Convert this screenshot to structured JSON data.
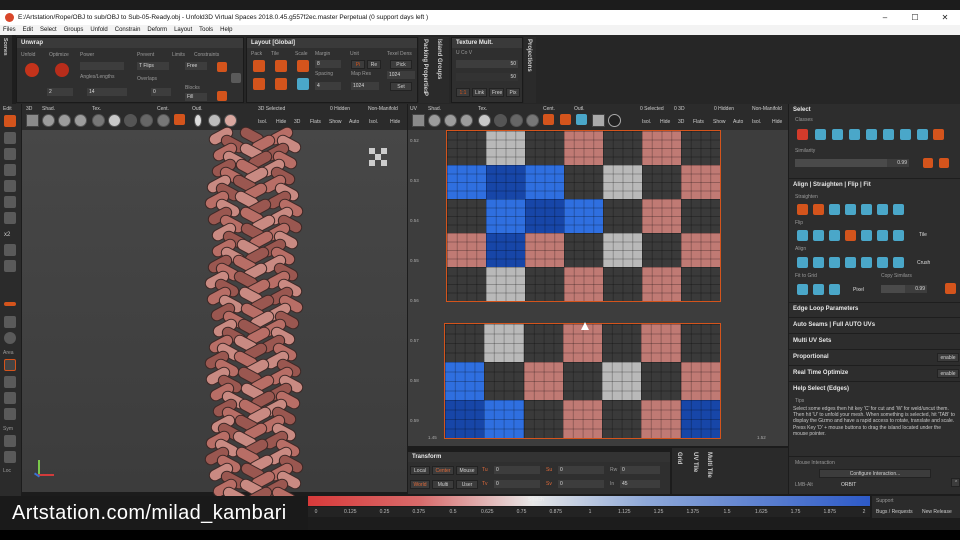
{
  "titlebar": {
    "title": "E:/Artstation/Rope/OBJ to sub/OBJ to Sub-05-Ready.obj - Unfold3D  Virtual Spaces 2018.0.45.g557f2ec.master Perpetual  (0 support days left )",
    "minimize": "–",
    "maximize": "☐",
    "close": "✕"
  },
  "menu": [
    "Files",
    "Edit",
    "Select",
    "Groups",
    "Unfold",
    "Constrain",
    "Deform",
    "Layout",
    "Tools",
    "Help"
  ],
  "left_strip": {
    "scenes": "Scenes",
    "edit": "Edit",
    "x2": "x2",
    "area": "Area",
    "sym": "Sym",
    "loc": "Loc"
  },
  "unwrap": {
    "title": "Unwrap",
    "labels": {
      "unfold": "Unfold",
      "optimize": "Optimize",
      "power": "Power",
      "prevent": "Prevent",
      "limits": "Limits",
      "constraints": "Constraints",
      "angles_lengths": "Angles/Lengths",
      "overlaps": "Overlaps",
      "blocks": "Blocks"
    },
    "values": {
      "power": "",
      "flips": "T Flips",
      "free": "Free",
      "v2": "2",
      "v14": "14",
      "v0": "0",
      "fill": "Fill"
    }
  },
  "layout": {
    "title": "Layout [Global]",
    "labels": {
      "pack": "Pack",
      "tile": "Tile",
      "scale": "Scale",
      "margin": "Margin",
      "unit": "Unit",
      "texel": "Texel Dens",
      "spacing": "Spacing",
      "map_res": "Map Res"
    },
    "values": {
      "margin": "8",
      "spacing": "4",
      "map_res": "1024",
      "texel": "1024",
      "pi": "Pi",
      "re": "Re",
      "pick": "Pick",
      "set": "Set"
    }
  },
  "side_tabs": {
    "packing": "Packing Properties",
    "p": "P",
    "island_groups": "Island Groups"
  },
  "texture": {
    "title": "Texture Mult.",
    "u": "U  Co V",
    "val1": "50",
    "val2": "50",
    "buttons": [
      "1:1",
      "Link",
      "Free",
      "Pix"
    ],
    "projections": "Projections"
  },
  "viewport3d": {
    "toolbar_top": [
      "3D",
      "Shad.",
      "Tex.",
      "Cent.",
      "Outl.",
      "3D Selected",
      "0 Hidden",
      "Non-Manifold"
    ],
    "toolbar_bottom": [
      "Isol.",
      "Hide",
      "3D",
      "Flats",
      "Show",
      "Auto",
      "Isol.",
      "Hide"
    ]
  },
  "viewportuv": {
    "toolbar_top": [
      "UV",
      "Shad.",
      "Tex.",
      "Cent.",
      "Outl.",
      "0 Selected",
      "0 3D",
      "0 Hidden",
      "Non-Manifold"
    ],
    "toolbar_bottom": [
      "Isol.",
      "Hide",
      "3D",
      "Flats",
      "Show",
      "Auto",
      "Isol.",
      "Hide"
    ],
    "ruler": [
      "0.52",
      "0.53",
      "0.54",
      "0.55",
      "0.56",
      "0.57",
      "0.58",
      "0.59"
    ],
    "bottom_ruler": [
      "1.45",
      "1.46",
      "1.47",
      "1.48",
      "1.49",
      "1.50",
      "1.51",
      "1.52"
    ]
  },
  "select_panel": {
    "title": "Select",
    "classes": "Classes",
    "similarity": "Similarity",
    "similarity_value": "0.99"
  },
  "align_panel": {
    "title": "Align | Straighten | Flip | Fit",
    "straighten": "Straighten",
    "flip": "Flip",
    "tile": "Tile",
    "align": "Align",
    "crush": "Crush",
    "fit_to_grid": "Fit to Grid",
    "copy_similars": "Copy Similars",
    "pixel": "Pixel",
    "copy_value": "0.99"
  },
  "sections": [
    "Edge Loop Parameters",
    "Auto Seams | Full AUTO UVs",
    "Multi UV Sets",
    "Proportional",
    "Real Time Optimize",
    "Help Select (Edges)"
  ],
  "toggles": {
    "proportional": "enable",
    "realtime": "enable"
  },
  "help": {
    "label": "Tips",
    "text": "Select some edges then hit key 'C' for cut and 'W' for weld/uncut them. Then hit 'U' to unfold your mesh. When something is selected, hit 'TAB' to display the Gizmo and have a rapid access to rotate, translate and scale. Press Key 'D' + mouse buttons to drag the island located under the mouse pointer."
  },
  "mouse_interaction": {
    "label": "Mouse Interaction",
    "configure": "Configure Interaction...",
    "lmb": "LMB-Alt",
    "orbit": "ORBIT"
  },
  "transform": {
    "title": "Transform",
    "row1": [
      "Local",
      "Center",
      "Mouse",
      "Tu",
      "0",
      "Su",
      "0",
      "Rw",
      "0"
    ],
    "row2": [
      "World",
      "Multi",
      "User",
      "Tv",
      "0",
      "Sv",
      "0",
      "In",
      "45"
    ]
  },
  "bottom_tabs": {
    "grid": "Grid",
    "uv_tile": "UV Tile",
    "multi_tile": "Multi Tile"
  },
  "colorbar": {
    "label": "Stretch",
    "ticks": [
      "0",
      "0.125",
      "0.25",
      "0.375",
      "0.5",
      "0.625",
      "0.75",
      "0.875",
      "1",
      "1.125",
      "1.25",
      "1.375",
      "1.5",
      "1.625",
      "1.75",
      "1.875",
      "2"
    ]
  },
  "support": {
    "label": "Support",
    "bugs": "Bugs / Requests",
    "release": "New Release"
  },
  "watermark": "Artstation.com/milad_kambari",
  "colors": {
    "accent": "#d4541c",
    "blue_stretch": "#1a5fd6",
    "red_checker": "#b8605e",
    "teal_icon": "#4aa7c9"
  }
}
